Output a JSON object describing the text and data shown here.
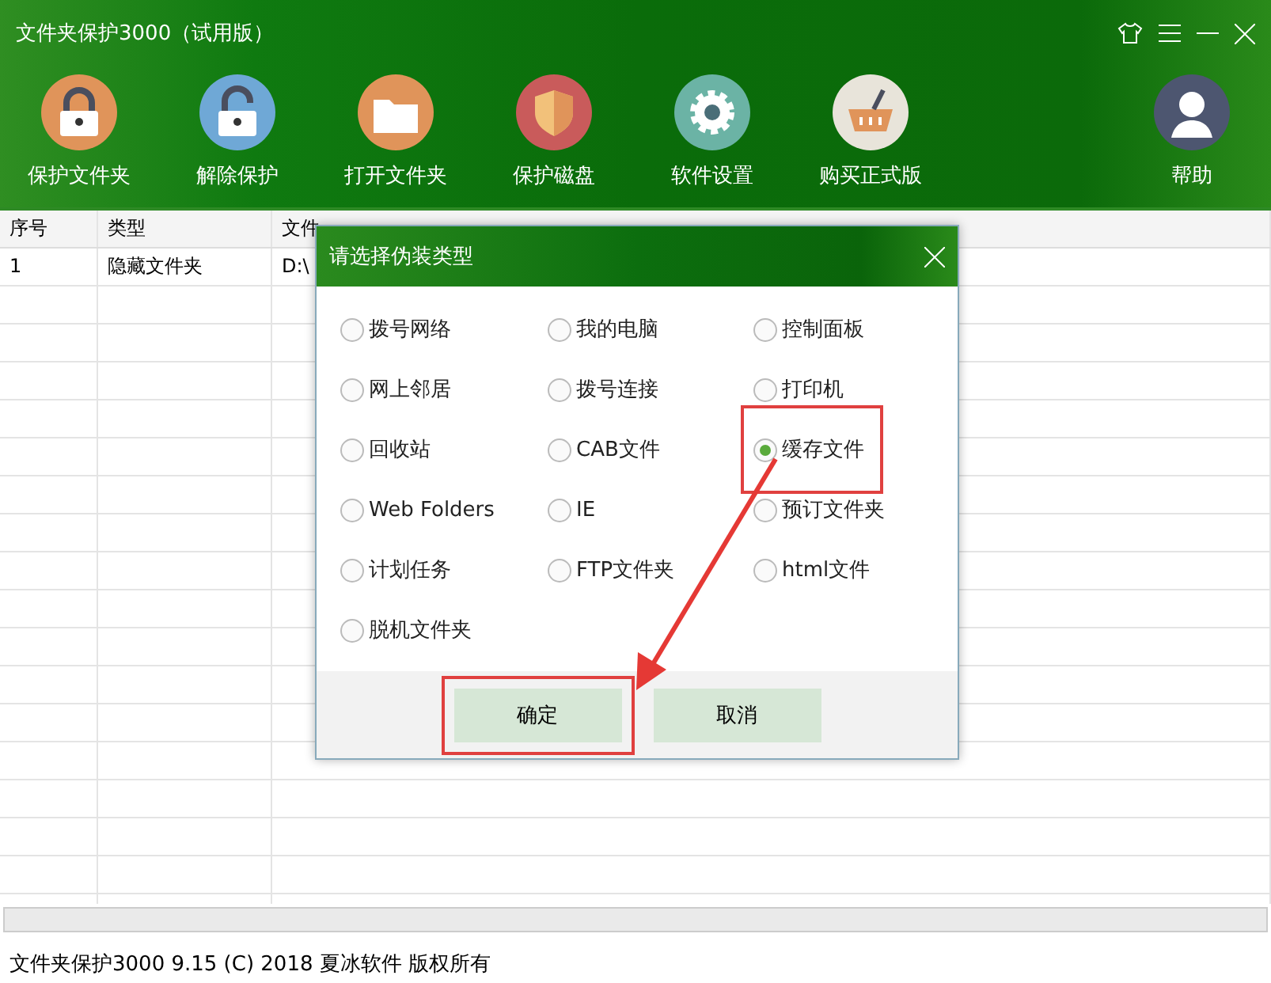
{
  "window": {
    "title": "文件夹保护3000（试用版）"
  },
  "toolbar": [
    {
      "kind": "lock",
      "label": "保护文件夹"
    },
    {
      "kind": "unlock",
      "label": "解除保护"
    },
    {
      "kind": "folder",
      "label": "打开文件夹"
    },
    {
      "kind": "shield",
      "label": "保护磁盘"
    },
    {
      "kind": "gear",
      "label": "软件设置"
    },
    {
      "kind": "basket",
      "label": "购买正式版"
    },
    {
      "kind": "user",
      "label": "帮助"
    }
  ],
  "table": {
    "columns": [
      "序号",
      "类型",
      "文件"
    ],
    "rows": [
      [
        "1",
        "隐藏文件夹",
        "D:\\"
      ]
    ]
  },
  "dialog": {
    "title": "请选择伪装类型",
    "options": [
      {
        "label": "拨号网络",
        "selected": false,
        "highlighted": false
      },
      {
        "label": "我的电脑",
        "selected": false,
        "highlighted": false
      },
      {
        "label": "控制面板",
        "selected": false,
        "highlighted": false
      },
      {
        "label": "网上邻居",
        "selected": false,
        "highlighted": false
      },
      {
        "label": "拨号连接",
        "selected": false,
        "highlighted": false
      },
      {
        "label": "打印机",
        "selected": false,
        "highlighted": false
      },
      {
        "label": "回收站",
        "selected": false,
        "highlighted": false
      },
      {
        "label": "CAB文件",
        "selected": false,
        "highlighted": false
      },
      {
        "label": "缓存文件",
        "selected": true,
        "highlighted": true
      },
      {
        "label": "Web Folders",
        "selected": false,
        "highlighted": false
      },
      {
        "label": "IE",
        "selected": false,
        "highlighted": false
      },
      {
        "label": "预订文件夹",
        "selected": false,
        "highlighted": false
      },
      {
        "label": "计划任务",
        "selected": false,
        "highlighted": false
      },
      {
        "label": "FTP文件夹",
        "selected": false,
        "highlighted": false
      },
      {
        "label": "html文件",
        "selected": false,
        "highlighted": false
      },
      {
        "label": "脱机文件夹",
        "selected": false,
        "highlighted": false
      }
    ],
    "buttons": [
      {
        "label": "确定",
        "highlighted": true
      },
      {
        "label": "取消",
        "highlighted": false
      }
    ]
  },
  "status_bar": "文件夹保护3000 9.15 (C) 2018 夏冰软件 版权所有"
}
